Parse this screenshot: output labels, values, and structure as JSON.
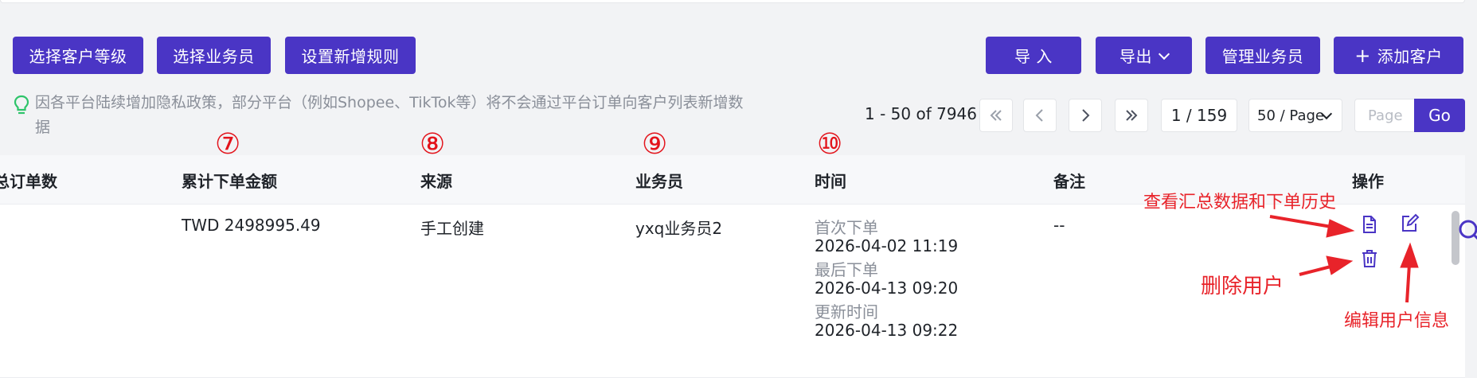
{
  "toolbar": {
    "left_buttons": [
      "选择客户等级",
      "选择业务员",
      "设置新增规则"
    ],
    "import_label": "导 入",
    "export_label": "导出",
    "manage_label": "管理业务员",
    "add_label": "添加客户",
    "add_symbol": "+"
  },
  "tip": {
    "text": "因各平台陆续增加隐私政策，部分平台（例如Shopee、TikTok等）将不会通过平台订单向客户列表新增数据"
  },
  "pagination": {
    "range": "1 - 50 of 7946",
    "page": "1 / 159",
    "page_size": "50 / Page",
    "page_placeholder": "Page",
    "go_label": "Go"
  },
  "table": {
    "headers": {
      "order_count": "总订单数",
      "amount": "累计下单金额",
      "source": "来源",
      "salesperson": "业务员",
      "time": "时间",
      "note": "备注",
      "actions": "操作"
    },
    "row": {
      "amount": "TWD 2498995.49",
      "source": "手工创建",
      "salesperson": "yxq业务员2",
      "first_order_label": "首次下单",
      "first_order": "2026-04-02 11:19",
      "last_order_label": "最后下单",
      "last_order": "2026-04-13 09:20",
      "updated_label": "更新时间",
      "updated": "2026-04-13 09:22",
      "note": "--"
    }
  },
  "annotations": {
    "marker_amount": "⑦",
    "marker_source": "⑧",
    "marker_salesperson": "⑨",
    "marker_time": "⑩",
    "view_summary": "查看汇总数据和下单历史",
    "delete_user": "删除用户",
    "edit_user": "编辑用户信息"
  },
  "colors": {
    "accent": "#4a35c5",
    "annotation": "#e3131b",
    "tip_icon": "#2ec46a"
  }
}
